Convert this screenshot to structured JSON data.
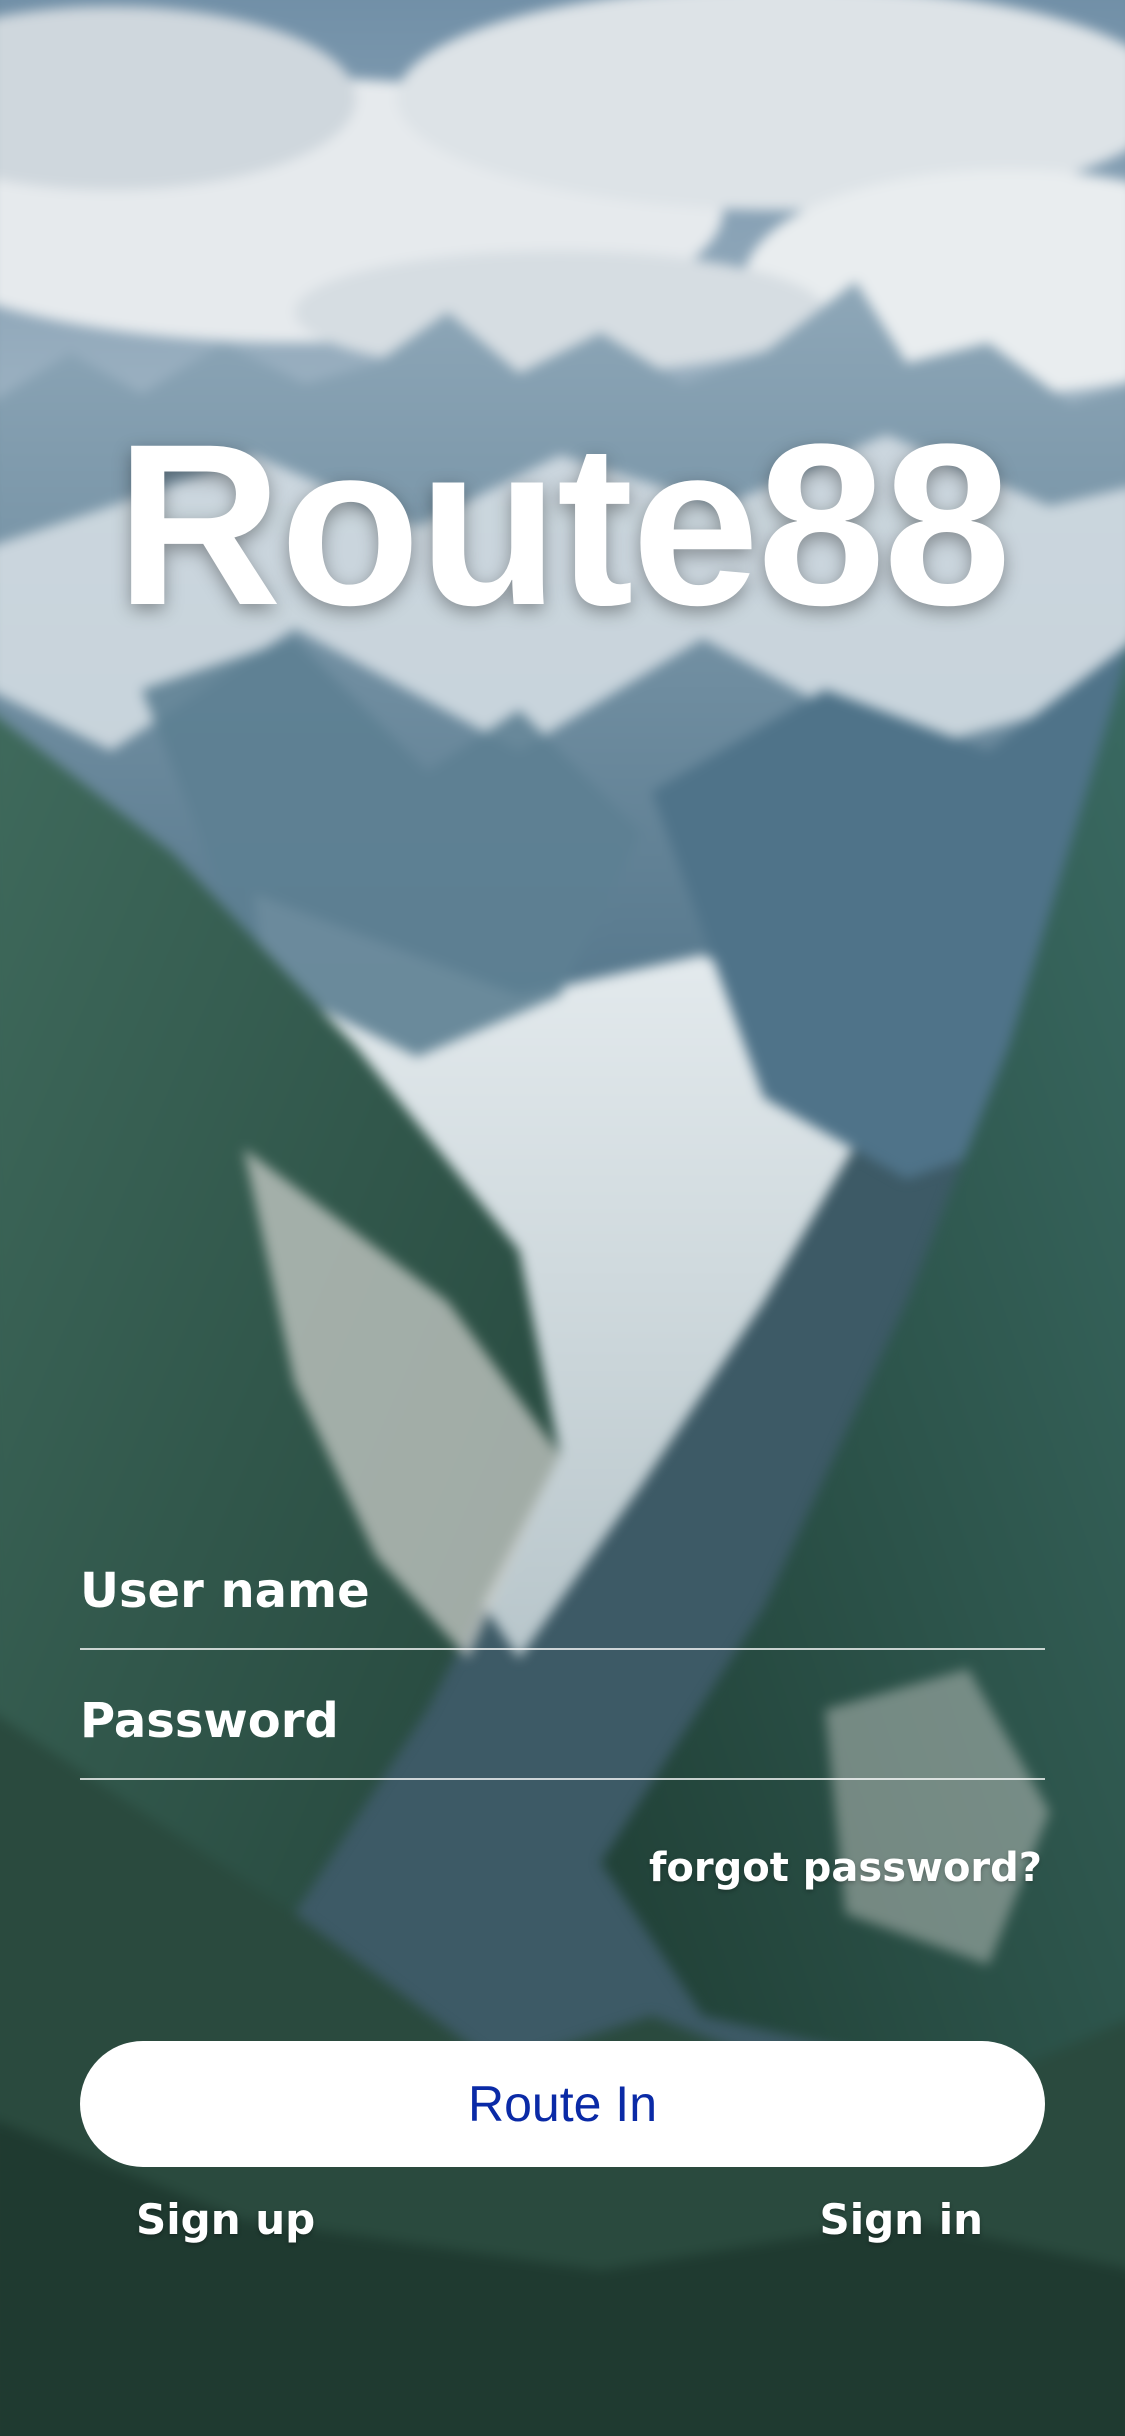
{
  "app": {
    "title": "Route88"
  },
  "login_form": {
    "username": {
      "value": "",
      "placeholder": "User name"
    },
    "password": {
      "value": "",
      "placeholder": "Password"
    },
    "forgot_password_label": "forgot password?",
    "submit_label": "Route In"
  },
  "footer": {
    "sign_up_label": "Sign up",
    "sign_in_label": "Sign in"
  },
  "background": {
    "scene": "mountain-valley-glacier",
    "sky_color": "#9fb4c4",
    "cloud_color": "#e8ecef",
    "mountain_color": "#5f7f93",
    "snow_color": "#dfe6ea",
    "forest_color": "#2f5446"
  },
  "colors": {
    "button_text": "#0a2aa6",
    "button_bg": "#ffffff",
    "text": "#ffffff"
  }
}
